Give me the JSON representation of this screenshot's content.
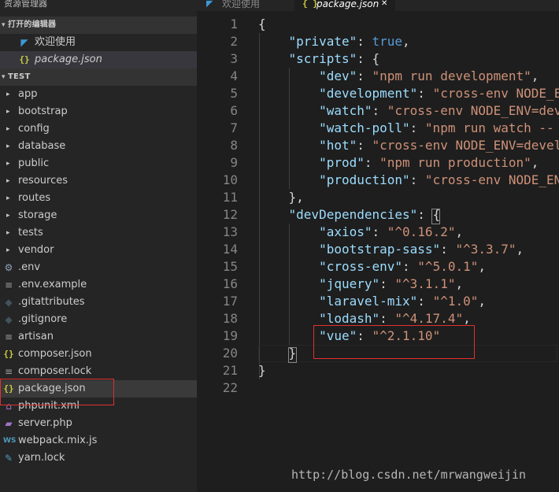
{
  "sidebar": {
    "title": "资源管理器",
    "open_editors_header": "打开的编辑器",
    "open_editors": [
      {
        "label": "欢迎使用",
        "icon": "vscode-icon"
      },
      {
        "label": "package.json",
        "icon": "json-icon"
      }
    ],
    "project_header": "TEST",
    "folders": [
      "app",
      "bootstrap",
      "config",
      "database",
      "public",
      "resources",
      "routes",
      "storage",
      "tests",
      "vendor"
    ],
    "files": [
      {
        "label": ".env",
        "icon": "gear-icon"
      },
      {
        "label": ".env.example",
        "icon": "lines-icon"
      },
      {
        "label": ".gitattributes",
        "icon": "dot-icon"
      },
      {
        "label": ".gitignore",
        "icon": "dot-icon"
      },
      {
        "label": "artisan",
        "icon": "lines-icon"
      },
      {
        "label": "composer.json",
        "icon": "json-icon"
      },
      {
        "label": "composer.lock",
        "icon": "lines-icon"
      },
      {
        "label": "package.json",
        "icon": "json-icon"
      },
      {
        "label": "phpunit.xml",
        "icon": "xml-icon"
      },
      {
        "label": "server.php",
        "icon": "php-icon"
      },
      {
        "label": "webpack.mix.js",
        "icon": "js-icon"
      },
      {
        "label": "yarn.lock",
        "icon": "yarn-icon"
      }
    ]
  },
  "tabs": [
    {
      "label": "欢迎使用",
      "icon_glyph": "◤",
      "active": false
    },
    {
      "label": "package.json",
      "icon_glyph": "{ }",
      "active": true,
      "close": "✕"
    }
  ],
  "editor": {
    "line_numbers": [
      "1",
      "2",
      "3",
      "4",
      "5",
      "6",
      "7",
      "8",
      "9",
      "10",
      "11",
      "12",
      "13",
      "14",
      "15",
      "16",
      "17",
      "18",
      "19",
      "20",
      "21",
      "22"
    ],
    "lines": [
      [
        [
          "p",
          "{"
        ]
      ],
      [
        [
          "p",
          "    "
        ],
        [
          "k",
          "\"private\""
        ],
        [
          "p",
          ": "
        ],
        [
          "b",
          "true"
        ],
        [
          "p",
          ","
        ]
      ],
      [
        [
          "p",
          "    "
        ],
        [
          "k",
          "\"scripts\""
        ],
        [
          "p",
          ": {"
        ]
      ],
      [
        [
          "p",
          "        "
        ],
        [
          "k",
          "\"dev\""
        ],
        [
          "p",
          ": "
        ],
        [
          "s",
          "\"npm run development\""
        ],
        [
          "p",
          ","
        ]
      ],
      [
        [
          "p",
          "        "
        ],
        [
          "k",
          "\"development\""
        ],
        [
          "p",
          ": "
        ],
        [
          "s",
          "\"cross-env NODE_E"
        ]
      ],
      [
        [
          "p",
          "        "
        ],
        [
          "k",
          "\"watch\""
        ],
        [
          "p",
          ": "
        ],
        [
          "s",
          "\"cross-env NODE_ENV=dev"
        ]
      ],
      [
        [
          "p",
          "        "
        ],
        [
          "k",
          "\"watch-poll\""
        ],
        [
          "p",
          ": "
        ],
        [
          "s",
          "\"npm run watch --"
        ]
      ],
      [
        [
          "p",
          "        "
        ],
        [
          "k",
          "\"hot\""
        ],
        [
          "p",
          ": "
        ],
        [
          "s",
          "\"cross-env NODE_ENV=devel"
        ]
      ],
      [
        [
          "p",
          "        "
        ],
        [
          "k",
          "\"prod\""
        ],
        [
          "p",
          ": "
        ],
        [
          "s",
          "\"npm run production\""
        ],
        [
          "p",
          ","
        ]
      ],
      [
        [
          "p",
          "        "
        ],
        [
          "k",
          "\"production\""
        ],
        [
          "p",
          ": "
        ],
        [
          "s",
          "\"cross-env NODE_EN"
        ]
      ],
      [
        [
          "p",
          "    },"
        ]
      ],
      [
        [
          "p",
          "    "
        ],
        [
          "k",
          "\"devDependencies\""
        ],
        [
          "p",
          ": {"
        ]
      ],
      [
        [
          "p",
          "        "
        ],
        [
          "k",
          "\"axios\""
        ],
        [
          "p",
          ": "
        ],
        [
          "s",
          "\"^0.16.2\""
        ],
        [
          "p",
          ","
        ]
      ],
      [
        [
          "p",
          "        "
        ],
        [
          "k",
          "\"bootstrap-sass\""
        ],
        [
          "p",
          ": "
        ],
        [
          "s",
          "\"^3.3.7\""
        ],
        [
          "p",
          ","
        ]
      ],
      [
        [
          "p",
          "        "
        ],
        [
          "k",
          "\"cross-env\""
        ],
        [
          "p",
          ": "
        ],
        [
          "s",
          "\"^5.0.1\""
        ],
        [
          "p",
          ","
        ]
      ],
      [
        [
          "p",
          "        "
        ],
        [
          "k",
          "\"jquery\""
        ],
        [
          "p",
          ": "
        ],
        [
          "s",
          "\"^3.1.1\""
        ],
        [
          "p",
          ","
        ]
      ],
      [
        [
          "p",
          "        "
        ],
        [
          "k",
          "\"laravel-mix\""
        ],
        [
          "p",
          ": "
        ],
        [
          "s",
          "\"^1.0\""
        ],
        [
          "p",
          ","
        ]
      ],
      [
        [
          "p",
          "        "
        ],
        [
          "k",
          "\"lodash\""
        ],
        [
          "p",
          ": "
        ],
        [
          "s",
          "\"^4.17.4\""
        ],
        [
          "p",
          ","
        ]
      ],
      [
        [
          "p",
          "        "
        ],
        [
          "k",
          "\"vue\""
        ],
        [
          "p",
          ": "
        ],
        [
          "s",
          "\"^2.1.10\""
        ]
      ],
      [
        [
          "p",
          "    }"
        ]
      ],
      [
        [
          "p",
          "}"
        ]
      ],
      [
        [
          "p",
          ""
        ]
      ]
    ]
  },
  "watermark": "http://blog.csdn.net/mrwangweijin"
}
